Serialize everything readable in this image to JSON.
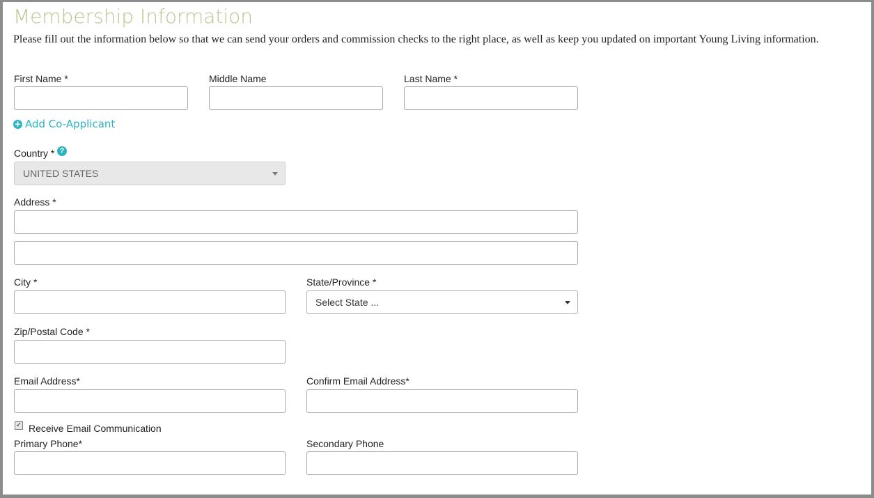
{
  "page": {
    "title": "Membership Information",
    "intro": "Please fill out the information below so that we can send your orders and commission checks to the right place, as well as keep you updated on important Young Living information."
  },
  "form": {
    "first_name_label": "First Name *",
    "middle_name_label": "Middle Name",
    "last_name_label": "Last Name *",
    "add_co_applicant": "Add Co-Applicant",
    "country_label": "Country *",
    "country_value": "UNITED STATES",
    "address_label": "Address *",
    "city_label": "City *",
    "state_label": "State/Province *",
    "state_value": "Select State ...",
    "zip_label": "Zip/Postal Code *",
    "email_label": "Email Address*",
    "confirm_email_label": "Confirm Email Address*",
    "receive_email_label": "Receive Email Communication",
    "receive_email_checked": true,
    "primary_phone_label": "Primary Phone*",
    "secondary_phone_label": "Secondary Phone"
  },
  "colors": {
    "title": "#b5c78f",
    "accent": "#2bb3c0",
    "frame": "#8c8c8c"
  },
  "icons": {
    "add": "plus-circle-icon",
    "help": "question-circle-icon",
    "caret": "caret-down-icon"
  }
}
